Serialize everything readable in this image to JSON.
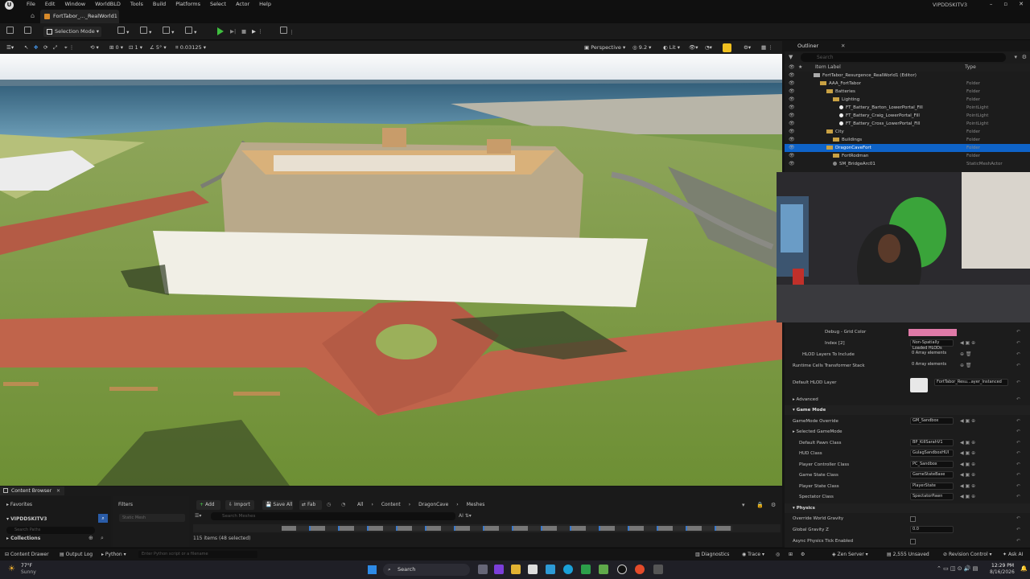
{
  "menubar": {
    "items": [
      "File",
      "Edit",
      "Window",
      "WorldBLD",
      "Tools",
      "Build",
      "Platforms",
      "Select",
      "Actor",
      "Help"
    ],
    "account": "VIPDDSKITV3"
  },
  "tab": {
    "title": "FortTabor_..._RealWorld1 •"
  },
  "toolbar": {
    "mode": "Selection Mode"
  },
  "viewport_bar": {
    "snap_value": "0.03125",
    "angle": "5°",
    "scale": "1",
    "grid": "0",
    "perspective": "Perspective",
    "fov": "9.2",
    "lit": "Lit"
  },
  "outliner": {
    "title": "Outliner",
    "search_placeholder": "Search",
    "col_label": "Item Label",
    "col_type": "Type",
    "rows": [
      {
        "label": "FortTabor_Resurgence_RealWorld1 (Editor)",
        "type": "",
        "indent": 36,
        "icon": "level"
      },
      {
        "label": "AAA_FortTabor",
        "type": "Folder",
        "indent": 44,
        "icon": "folder"
      },
      {
        "label": "Batteries",
        "type": "Folder",
        "indent": 52,
        "icon": "folder"
      },
      {
        "label": "Lighting",
        "type": "Folder",
        "indent": 60,
        "icon": "folder"
      },
      {
        "label": "FT_Battery_Barton_LowerPortal_Fill",
        "type": "PointLight",
        "indent": 68,
        "icon": "light"
      },
      {
        "label": "FT_Battery_Craig_LowerPortal_Fill",
        "type": "PointLight",
        "indent": 68,
        "icon": "light"
      },
      {
        "label": "FT_Battery_Cross_LowerPortal_Fill",
        "type": "PointLight",
        "indent": 68,
        "icon": "light"
      },
      {
        "label": "City",
        "type": "Folder",
        "indent": 52,
        "icon": "folder"
      },
      {
        "label": "Buildings",
        "type": "Folder",
        "indent": 60,
        "icon": "folder"
      },
      {
        "label": "DragonCaveFort",
        "type": "Folder",
        "indent": 52,
        "icon": "folder",
        "selected": true
      },
      {
        "label": "FortRodman",
        "type": "Folder",
        "indent": 60,
        "icon": "folder"
      },
      {
        "label": "SM_BridgeArc01",
        "type": "StaticMeshActor",
        "indent": 60,
        "icon": "mesh"
      }
    ]
  },
  "details": {
    "rows": [
      {
        "label": "Debug - Grid Color",
        "value": "",
        "kind": "color",
        "indent": 50
      },
      {
        "label": "Index [2]",
        "value": "Non-Spatially Loaded HLODs",
        "kind": "dropdown",
        "indent": 50
      },
      {
        "label": "HLOD Layers To Include",
        "value": "0 Array elements",
        "kind": "array",
        "indent": 22
      },
      {
        "label": "Runtime Cells Transformer Stack",
        "value": "0 Array elements",
        "kind": "array",
        "indent": 10
      },
      {
        "label": "Default HLOD Layer",
        "value": "FortTabor_Resu...ayer_Instanced",
        "kind": "asset",
        "indent": 10
      },
      {
        "label": "Advanced",
        "value": "",
        "kind": "expander",
        "indent": 10
      },
      {
        "label": "Game Mode",
        "value": "",
        "kind": "section",
        "indent": 10
      },
      {
        "label": "GameMode Override",
        "value": "GM_Sandbox",
        "kind": "dropdown",
        "indent": 10
      },
      {
        "label": "Selected GameMode",
        "value": "",
        "kind": "expander",
        "indent": 10
      },
      {
        "label": "Default Pawn Class",
        "value": "BP_KillSarahV1",
        "kind": "dropdown",
        "indent": 18
      },
      {
        "label": "HUD Class",
        "value": "GulagSandboxHUI",
        "kind": "dropdown",
        "indent": 18
      },
      {
        "label": "Player Controller Class",
        "value": "PC_Sandbox",
        "kind": "dropdown",
        "indent": 18
      },
      {
        "label": "Game State Class",
        "value": "GameStateBase",
        "kind": "dropdown",
        "indent": 18
      },
      {
        "label": "Player State Class",
        "value": "PlayerState",
        "kind": "dropdown",
        "indent": 18
      },
      {
        "label": "Spectator Class",
        "value": "SpectatorPawn",
        "kind": "dropdown",
        "indent": 18
      },
      {
        "label": "Physics",
        "value": "",
        "kind": "section",
        "indent": 10
      },
      {
        "label": "Override World Gravity",
        "value": "",
        "kind": "checkbox",
        "indent": 10
      },
      {
        "label": "Global Gravity Z",
        "value": "0.0",
        "kind": "number",
        "indent": 10
      },
      {
        "label": "Async Physics Tick Enabled",
        "value": "",
        "kind": "checkbox",
        "indent": 10
      }
    ]
  },
  "content_browser": {
    "tab": "Content Browser",
    "favorites": "Favorites",
    "root": "VIPDDSKITV3",
    "collections": "Collections",
    "search_paths_placeholder": "Search Paths",
    "filters": "Filters",
    "filter_chip": "Static Mesh",
    "add": "Add",
    "import": "Import",
    "save_all": "Save All",
    "fab": "Fab",
    "breadcrumb": [
      "All",
      "Content",
      "DragonCave",
      "Meshes"
    ],
    "search_placeholder": "Search Meshes",
    "item_count": "115 items (48 selected)"
  },
  "statusbar": {
    "content_drawer": "Content Drawer",
    "output_log": "Output Log",
    "cmd": "Python",
    "cmd_placeholder": "Enter Python script or a filename",
    "diagnostics": "Diagnostics",
    "trace": "Trace",
    "zen": "Zen Server",
    "unsaved": "2,555 Unsaved",
    "revision": "Revision Control",
    "ask": "Ask AI"
  },
  "taskbar": {
    "temp": "77°F",
    "weather": "Sunny",
    "search": "Search",
    "time": "12:29 PM",
    "date": "8/16/2026"
  }
}
